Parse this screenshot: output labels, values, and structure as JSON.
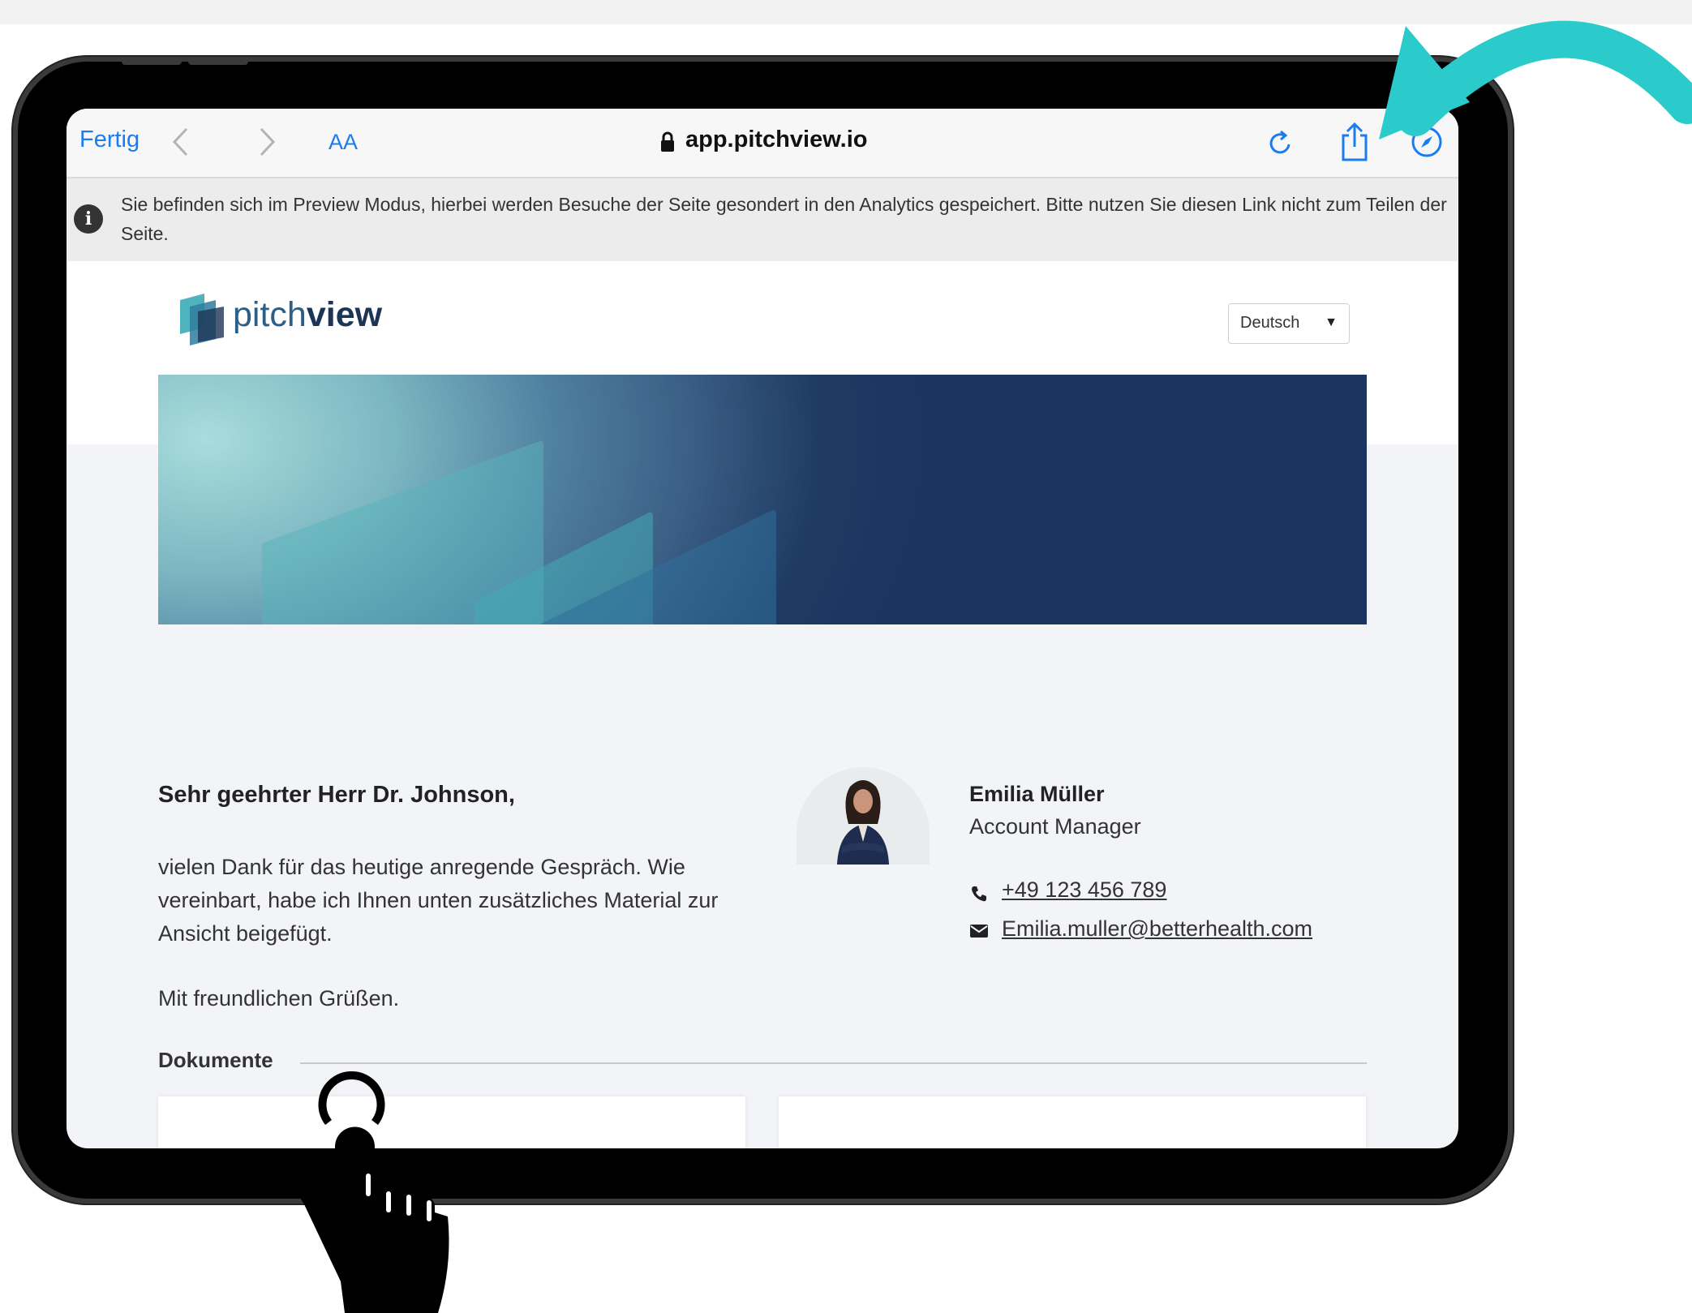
{
  "browser": {
    "done_label": "Fertig",
    "text_size_label": "AA",
    "url": "app.pitchview.io"
  },
  "notice": {
    "text": "Sie befinden sich im Preview Modus, hierbei werden Besuche der Seite gesondert in den Analytics gespeichert. Bitte nutzen Sie diesen Link nicht zum Teilen der Seite.",
    "icon_label": "i"
  },
  "header": {
    "logo_part1": "pitch",
    "logo_part2": "view",
    "language": "Deutsch"
  },
  "message": {
    "greeting": "Sehr geehrter Herr Dr. Johnson,",
    "body": "vielen Dank für das heutige anregende Gespräch. Wie vereinbart, habe ich Ihnen unten zusätzliches Material zur Ansicht beigefügt.",
    "closing": "Mit freundlichen Grüßen."
  },
  "contact": {
    "name": "Emilia Müller",
    "role": "Account Manager",
    "phone": "+49 123 456 789",
    "email": "Emilia.muller@betterhealth.com"
  },
  "documents": {
    "heading": "Dokumente"
  },
  "colors": {
    "accent": "#1a7cf0",
    "arrow": "#2ccbcb",
    "banner_dark": "#1a3560",
    "banner_light": "#a9dcdc"
  }
}
